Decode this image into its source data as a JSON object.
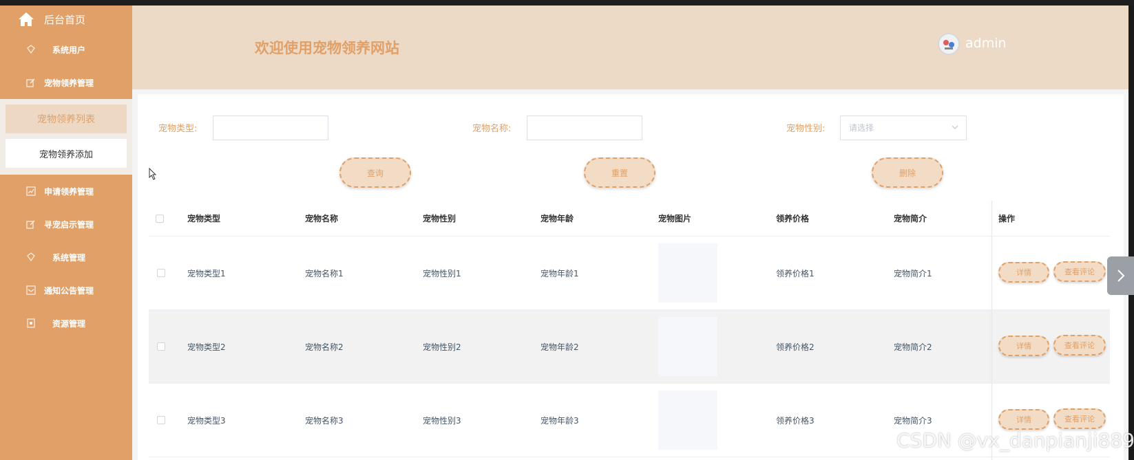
{
  "sidebar": {
    "home_label": "后台首页",
    "items": [
      {
        "label": "系统用户"
      },
      {
        "label": "宠物领养管理"
      },
      {
        "label": "申请领养管理"
      },
      {
        "label": "寻宠启示管理"
      },
      {
        "label": "系统管理"
      },
      {
        "label": "通知公告管理"
      },
      {
        "label": "资源管理"
      }
    ],
    "submenu": [
      {
        "label": "宠物领养列表",
        "active": true
      },
      {
        "label": "宠物领养添加",
        "active": false
      }
    ]
  },
  "header": {
    "welcome": "欢迎使用宠物领养网站",
    "username": "admin"
  },
  "filters": {
    "type_label": "宠物类型:",
    "type_value": "",
    "name_label": "宠物名称:",
    "name_value": "",
    "gender_label": "宠物性别:",
    "gender_placeholder": "请选择"
  },
  "actions": {
    "search": "查询",
    "reset": "重置",
    "delete": "删除"
  },
  "table": {
    "headers": [
      "宠物类型",
      "宠物名称",
      "宠物性别",
      "宠物年龄",
      "宠物图片",
      "领养价格",
      "宠物简介",
      "操作"
    ],
    "rows": [
      {
        "type": "宠物类型1",
        "name": "宠物名称1",
        "gender": "宠物性别1",
        "age": "宠物年龄1",
        "price": "领养价格1",
        "intro": "宠物简介1"
      },
      {
        "type": "宠物类型2",
        "name": "宠物名称2",
        "gender": "宠物性别2",
        "age": "宠物年龄2",
        "price": "领养价格2",
        "intro": "宠物简介2"
      },
      {
        "type": "宠物类型3",
        "name": "宠物名称3",
        "gender": "宠物性别3",
        "age": "宠物年龄3",
        "price": "领养价格3",
        "intro": "宠物简介3"
      }
    ],
    "op_detail": "详情",
    "op_comments": "查看评论"
  },
  "watermark": "CSDN @vx_danpianji889",
  "colors": {
    "accent": "#e0a068",
    "header_bg": "#eddac6",
    "pill_bg": "#f2dcc5"
  }
}
